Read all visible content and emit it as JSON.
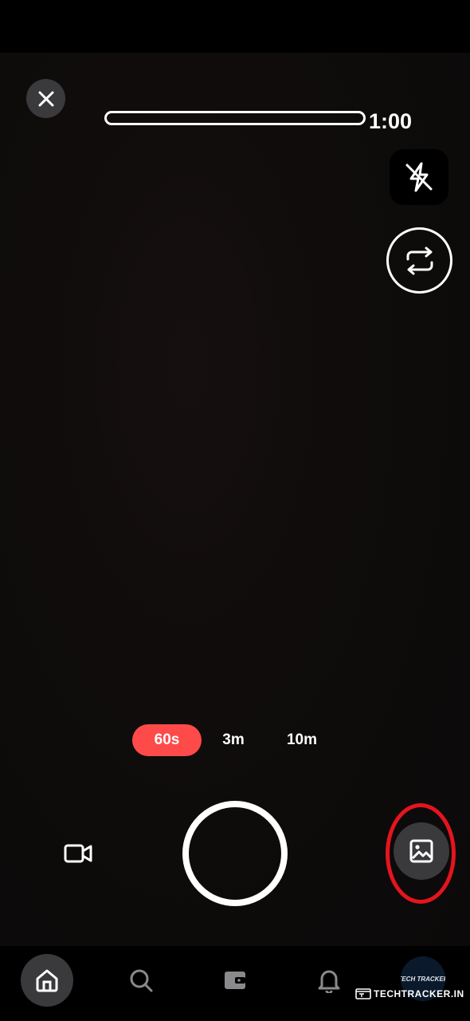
{
  "camera": {
    "timer": "1:00",
    "recording_progress": 0,
    "durations": [
      {
        "label": "60s",
        "selected": true
      },
      {
        "label": "3m",
        "selected": false
      },
      {
        "label": "10m",
        "selected": false
      }
    ]
  },
  "icons": {
    "close": "close-icon",
    "flash": "flash-off-icon",
    "flip": "flip-camera-icon",
    "video": "video-camera-icon",
    "gallery": "gallery-icon"
  },
  "bottom_nav": {
    "items": [
      {
        "icon": "home-icon",
        "active": true
      },
      {
        "icon": "search-icon",
        "active": false
      },
      {
        "icon": "wallet-icon",
        "active": false
      },
      {
        "icon": "bell-icon",
        "active": false
      },
      {
        "icon": "avatar",
        "active": false
      }
    ],
    "avatar_text": "TECH TRACKER"
  },
  "watermark": "TECHTRACKER.IN",
  "colors": {
    "accent": "#ff4a4a",
    "highlight": "#e5141d",
    "button_bg": "#3a3a3c"
  }
}
